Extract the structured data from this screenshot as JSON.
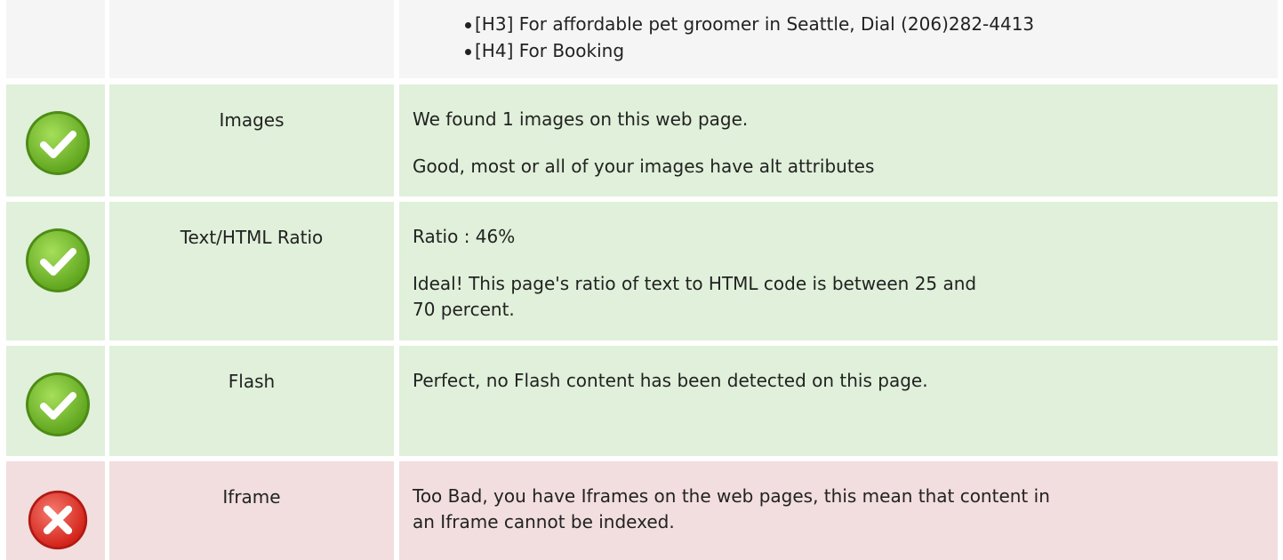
{
  "headings_row": {
    "items": [
      "[H3] For affordable pet groomer in Seattle, Dial (206)282-4413",
      "[H4] For Booking"
    ]
  },
  "rows": [
    {
      "status": "pass",
      "icon": "check-circle-icon",
      "label": "Images",
      "lines": [
        "We found 1 images on this web page.",
        "Good, most or all of your images have alt attributes"
      ]
    },
    {
      "status": "pass",
      "icon": "check-circle-icon",
      "label": "Text/HTML Ratio",
      "lines": [
        "Ratio : 46%",
        "Ideal! This page's ratio of text to HTML code is between 25 and 70 percent."
      ]
    },
    {
      "status": "pass",
      "icon": "check-circle-icon",
      "label": "Flash",
      "lines": [
        "Perfect, no Flash content has been detected on this page."
      ]
    },
    {
      "status": "fail",
      "icon": "error-circle-icon",
      "label": "Iframe",
      "lines": [
        "Too Bad, you have Iframes on the web pages, this mean that content in an Iframe cannot be indexed."
      ]
    }
  ],
  "colors": {
    "pass_bg": "#e0f0da",
    "fail_bg": "#f2dedf",
    "neutral_bg": "#f5f5f5",
    "pass_icon": "#7cc52d",
    "fail_icon": "#e03030"
  }
}
